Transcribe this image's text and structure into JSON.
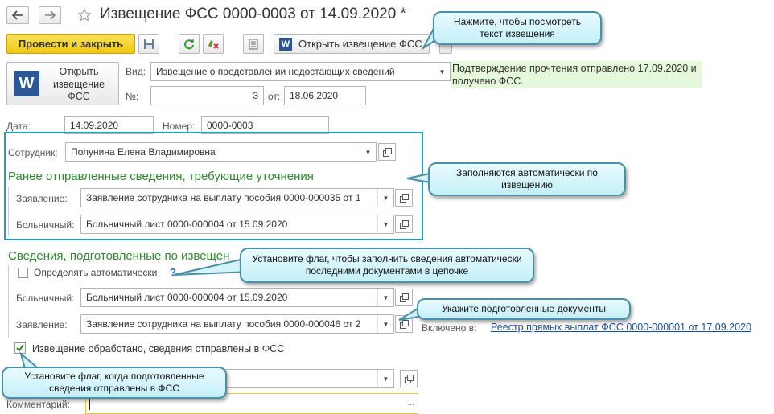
{
  "header": {
    "back_icon": "arrow-left-icon",
    "forward_icon": "arrow-right-icon",
    "favorite_icon": "star-icon",
    "title": "Извещение ФСС 0000-0003 от 14.09.2020 *"
  },
  "toolbar": {
    "post_close_label": "Провести и закрыть",
    "open_notice_label": "Открыть извещение ФСС"
  },
  "big_button": {
    "line1": "Открыть",
    "line2": "извещение",
    "line3": "ФСС"
  },
  "form": {
    "vid_label": "Вид:",
    "vid_value": "Извещение о представлении недостающих сведений",
    "num_label": "№:",
    "num_value": "3",
    "ot_label": "от:",
    "ot_value": "18.06.2020",
    "status_text": "Подтверждение прочтения отправлено 17.09.2020 и получено ФСС.",
    "date_label": "Дата:",
    "date_value": "14.09.2020",
    "number_label": "Номер:",
    "number_value": "0000-0003",
    "employee_label": "Сотрудник:",
    "employee_value": "Полунина Елена Владимировна"
  },
  "section1": {
    "title": "Ранее отправленные сведения, требующие уточнения",
    "statement_label": "Заявление:",
    "statement_value": "Заявление сотрудника на выплату пособия 0000-000035 от 1",
    "sick_label": "Больничный:",
    "sick_value": "Больничный лист 0000-000004 от 15.09.2020"
  },
  "section2": {
    "title": "Сведения, подготовленные по извещен",
    "auto_label": "Определять автоматически",
    "auto_help": "?",
    "sick_label": "Больничный:",
    "sick_value": "Больничный лист 0000-000004 от 15.09.2020",
    "statement_label": "Заявление:",
    "statement_value": "Заявление сотрудника на выплату пособия 0000-000046 от 2",
    "included_label": "Включено в:",
    "included_link": "Реестр прямых выплат ФСС 0000-000001 от 17.09.2020",
    "processed_label": "Извещение обработано, сведения отправлены в ФСС"
  },
  "comment_label": "Комментарий:",
  "callouts": {
    "open_notice": "Нажмите, чтобы посмотреть текст извещения",
    "auto_fill": "Заполняются автоматически по извещению",
    "set_flag_auto": "Установите флаг, чтобы заполнить сведения автоматически последними документами в цепочке",
    "specify_docs": "Укажите подготовленные документы",
    "set_flag_sent": "Установите флаг, когда подготовленные сведения отправлены в ФСС"
  },
  "colors": {
    "primary_button": "#f5d11c",
    "section_title": "#2e8b2e",
    "frame": "#1aa3b5",
    "status_bg": "#e6f8dc",
    "link": "#1a4f9c"
  }
}
